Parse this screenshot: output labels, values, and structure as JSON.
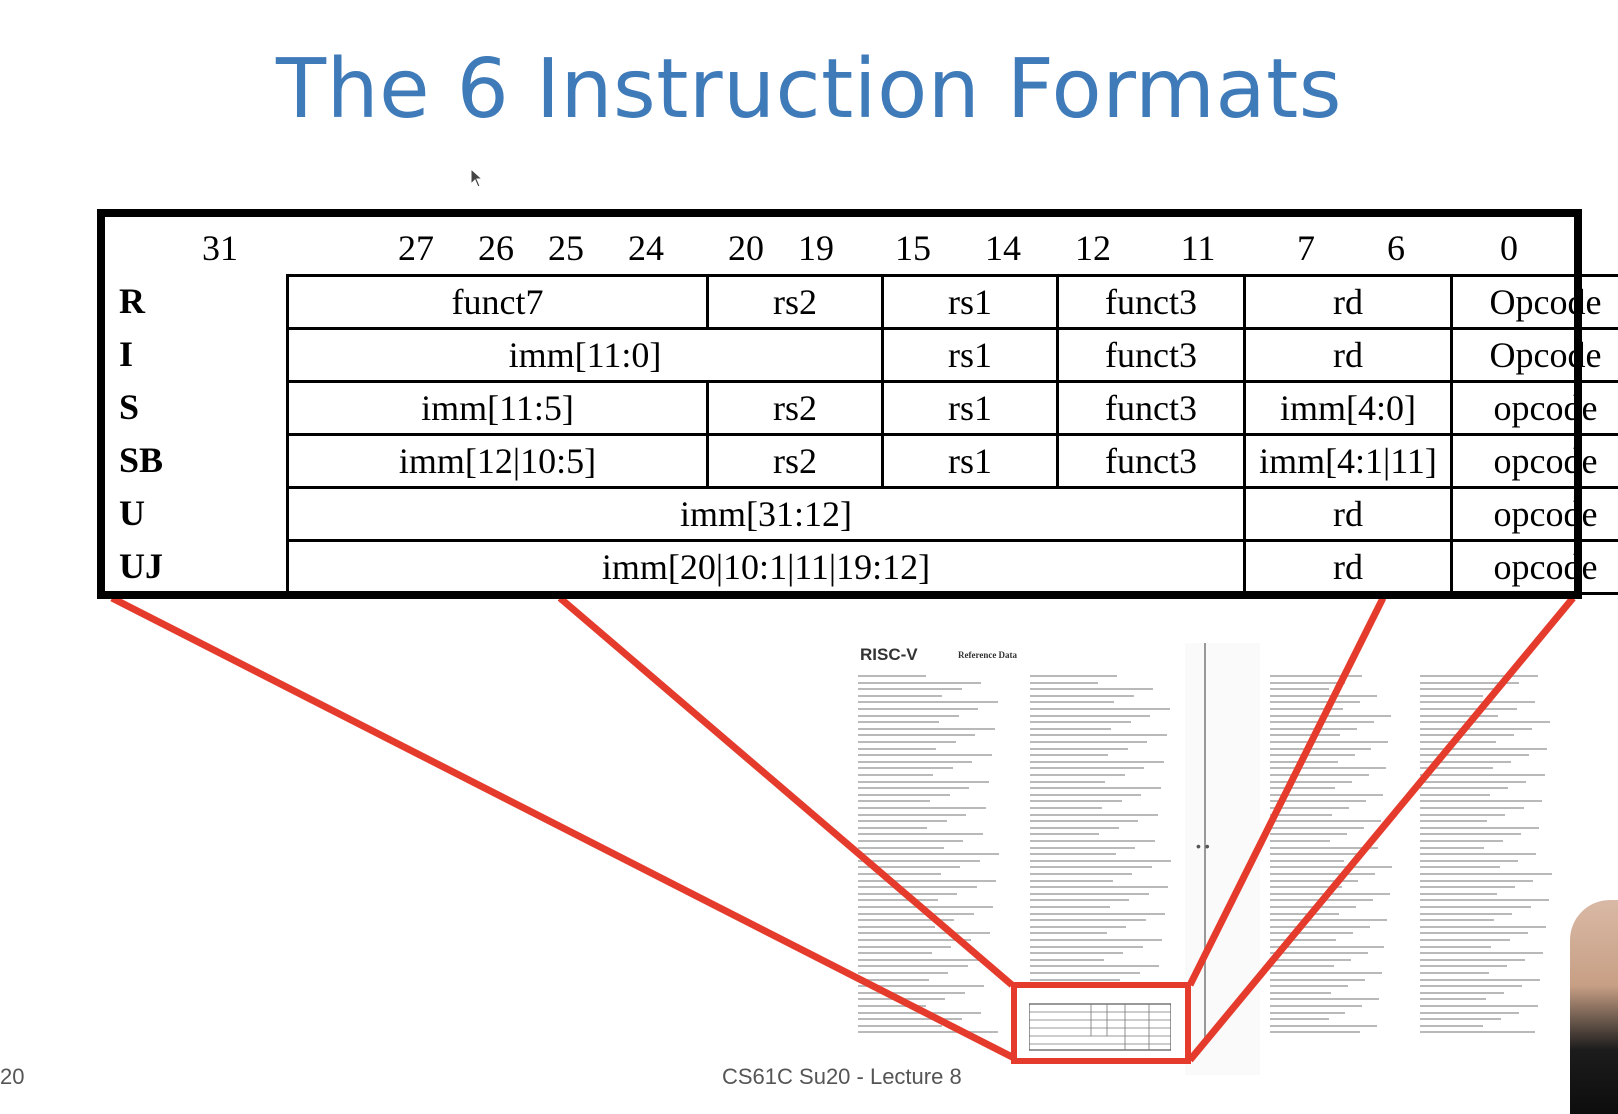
{
  "slide": {
    "title": "The 6 Instruction Formats",
    "footer_left": "20",
    "footer_center": "CS61C Su20 - Lecture 8"
  },
  "bit_positions": [
    "31",
    "27",
    "26",
    "25",
    "24",
    "20",
    "19",
    "15",
    "14",
    "12",
    "11",
    "7",
    "6",
    "0"
  ],
  "formats": [
    {
      "label": "R",
      "fields": [
        "funct7",
        "rs2",
        "rs1",
        "funct3",
        "rd",
        "Opcode"
      ]
    },
    {
      "label": "I",
      "fields": [
        "imm[11:0]",
        "rs1",
        "funct3",
        "rd",
        "Opcode"
      ]
    },
    {
      "label": "S",
      "fields": [
        "imm[11:5]",
        "rs2",
        "rs1",
        "funct3",
        "imm[4:0]",
        "opcode"
      ]
    },
    {
      "label": "SB",
      "fields": [
        "imm[12|10:5]",
        "rs2",
        "rs1",
        "funct3",
        "imm[4:1|11]",
        "opcode"
      ]
    },
    {
      "label": "U",
      "fields": [
        "imm[31:12]",
        "rd",
        "opcode"
      ]
    },
    {
      "label": "UJ",
      "fields": [
        "imm[20|10:1|11|19:12]",
        "rd",
        "opcode"
      ]
    }
  ],
  "reference_card": {
    "logo": "RISC-V",
    "heading": "Reference Data"
  },
  "colors": {
    "title": "#3f7ab9",
    "zoom_lines": "#e53b2c",
    "table_border": "#000000"
  }
}
